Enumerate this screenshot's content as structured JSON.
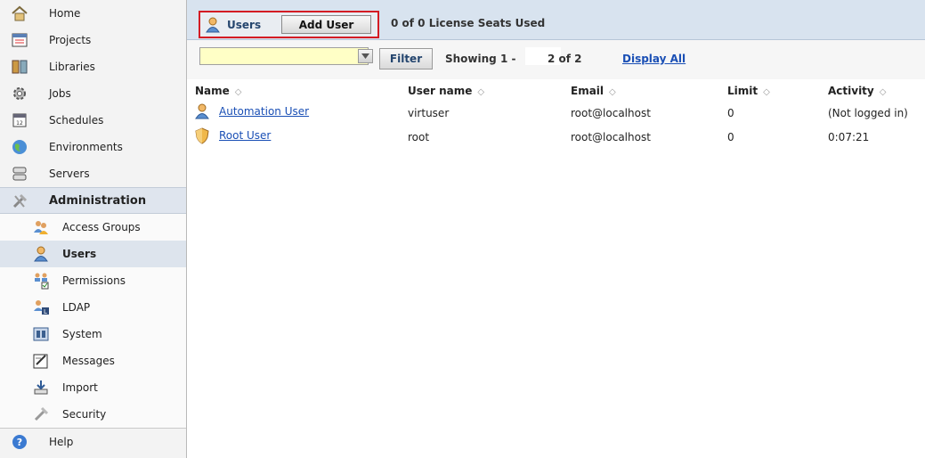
{
  "sidebar": {
    "items": [
      {
        "label": "Home",
        "icon": "home-icon"
      },
      {
        "label": "Projects",
        "icon": "projects-icon"
      },
      {
        "label": "Libraries",
        "icon": "libraries-icon"
      },
      {
        "label": "Jobs",
        "icon": "gear-icon"
      },
      {
        "label": "Schedules",
        "icon": "calendar-icon"
      },
      {
        "label": "Environments",
        "icon": "globe-icon"
      },
      {
        "label": "Servers",
        "icon": "server-icon"
      },
      {
        "label": "Administration",
        "icon": "tools-icon"
      }
    ],
    "admin_items": [
      {
        "label": "Access Groups",
        "icon": "group-icon"
      },
      {
        "label": "Users",
        "icon": "user-icon"
      },
      {
        "label": "Permissions",
        "icon": "permissions-icon"
      },
      {
        "label": "LDAP",
        "icon": "ldap-icon"
      },
      {
        "label": "System",
        "icon": "system-icon"
      },
      {
        "label": "Messages",
        "icon": "messages-icon"
      },
      {
        "label": "Import",
        "icon": "import-icon"
      },
      {
        "label": "Security",
        "icon": "security-icon"
      }
    ],
    "help": {
      "label": "Help",
      "icon": "help-icon"
    }
  },
  "toolbar": {
    "users_tab": "Users",
    "add_user": "Add User",
    "seats": "0 of 0 License Seats Used"
  },
  "filter": {
    "value": "",
    "button": "Filter",
    "showing": "Showing 1 -",
    "page_info": "2 of 2",
    "display_all": "Display All"
  },
  "table": {
    "columns": [
      "Name",
      "User name",
      "Email",
      "Limit",
      "Activity"
    ],
    "rows": [
      {
        "name": "Automation User",
        "username": "virtuser",
        "email": "root@localhost",
        "limit": "0",
        "activity": "(Not logged in)",
        "icon": "user-icon"
      },
      {
        "name": "Root User",
        "username": "root",
        "email": "root@localhost",
        "limit": "0",
        "activity": "0:07:21",
        "icon": "shield-icon"
      }
    ]
  },
  "colors": {
    "highlight_border": "#d41c24",
    "link": "#1a4fb5",
    "filter_input_bg": "#ffffc6"
  }
}
